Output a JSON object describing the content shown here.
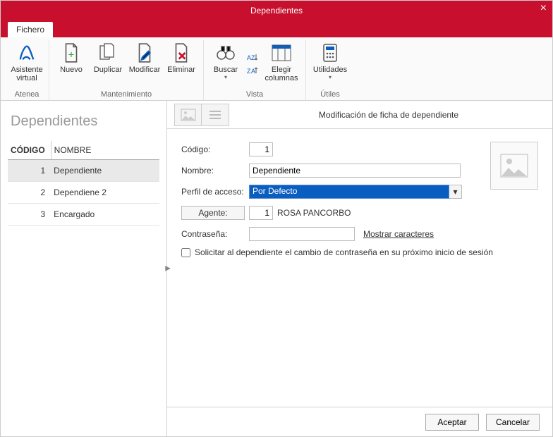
{
  "window": {
    "title": "Dependientes"
  },
  "tabs": {
    "file": "Fichero"
  },
  "ribbon": {
    "assistant_group_label": "",
    "assistant": {
      "label": "Asistente\nvirtual",
      "sublabel": "Atenea"
    },
    "maintenance": {
      "new": "Nuevo",
      "duplicate": "Duplicar",
      "modify": "Modificar",
      "delete": "Eliminar",
      "group": "Mantenimiento"
    },
    "view": {
      "search": "Buscar",
      "choose_columns": "Elegir\ncolumnas",
      "group": "Vista"
    },
    "utils": {
      "utilities": "Utilidades",
      "group": "Útiles"
    }
  },
  "list": {
    "heading": "Dependientes",
    "columns": {
      "code": "CÓDIGO",
      "name": "NOMBRE"
    },
    "rows": [
      {
        "code": "1",
        "name": "Dependiente",
        "selected": true
      },
      {
        "code": "2",
        "name": "Dependiene 2",
        "selected": false
      },
      {
        "code": "3",
        "name": "Encargado",
        "selected": false
      }
    ]
  },
  "detail": {
    "title": "Modificación de ficha de dependiente",
    "labels": {
      "code": "Código:",
      "name": "Nombre:",
      "profile": "Perfil de acceso:",
      "agent": "Agente:",
      "password": "Contraseña:"
    },
    "values": {
      "code": "1",
      "name": "Dependiente",
      "profile": "Por Defecto",
      "agent_code": "1",
      "agent_name": "ROSA PANCORBO",
      "password": ""
    },
    "show_chars": "Mostrar caracteres",
    "force_change": "Solicitar al dependiente el cambio de contraseña en su próximo inicio de sesión"
  },
  "buttons": {
    "ok": "Aceptar",
    "cancel": "Cancelar"
  }
}
